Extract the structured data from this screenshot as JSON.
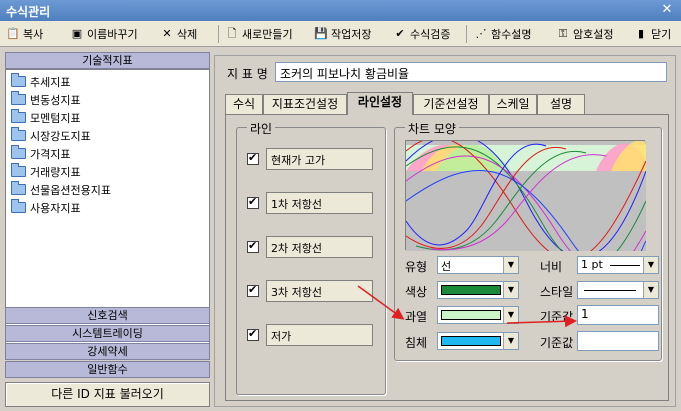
{
  "window": {
    "title": "수식관리",
    "close_glyph": "✕"
  },
  "toolbar": {
    "copy": "복사",
    "rename": "이름바꾸기",
    "delete": "삭제",
    "new": "새로만들기",
    "save": "작업저장",
    "verify": "수식검증",
    "help": "함수설명",
    "password": "암호설정",
    "close": "닫기"
  },
  "left": {
    "header": "기술적지표",
    "items": [
      "추세지표",
      "변동성지표",
      "모멘텀지표",
      "시장강도지표",
      "가격지표",
      "거래량지표",
      "선물옵션전용지표",
      "사용자지표"
    ],
    "sections": [
      "신호검색",
      "시스템트레이딩",
      "강세약세",
      "일반함수"
    ],
    "load_button": "다른 ID 지표 불러오기"
  },
  "right": {
    "name_label": "지 표 명",
    "name_value": "조커의 피보나치 황금비율",
    "tabs": [
      "수식",
      "지표조건설정",
      "라인설정",
      "기준선설정",
      "스케일",
      "설명"
    ],
    "active_tab": "라인설정"
  },
  "line_group": {
    "legend": "라인",
    "lines": [
      {
        "label": "현재가 고가",
        "checked": true
      },
      {
        "label": "1차 저항선",
        "checked": true
      },
      {
        "label": "2차 저항선",
        "checked": true
      },
      {
        "label": "3차 저항선",
        "checked": true
      },
      {
        "label": "저가",
        "checked": true
      }
    ]
  },
  "chart_group": {
    "legend": "차트 모양",
    "type_label": "유형",
    "type_value": "선",
    "color_label": "색상",
    "color_value": "#1a8a3a",
    "band_label": "과열",
    "band_value": "#c8f4c8",
    "sink_label": "침체",
    "sink_value": "#20b8f0",
    "width_label": "너비",
    "width_value": "1 pt",
    "style_label": "스타일",
    "base_label": "기준값",
    "base_value": "1",
    "base2_label": "기준값",
    "base2_value": ""
  },
  "colors": {
    "arrow": "#e02020",
    "preview_bg": "#c0c0c0"
  }
}
